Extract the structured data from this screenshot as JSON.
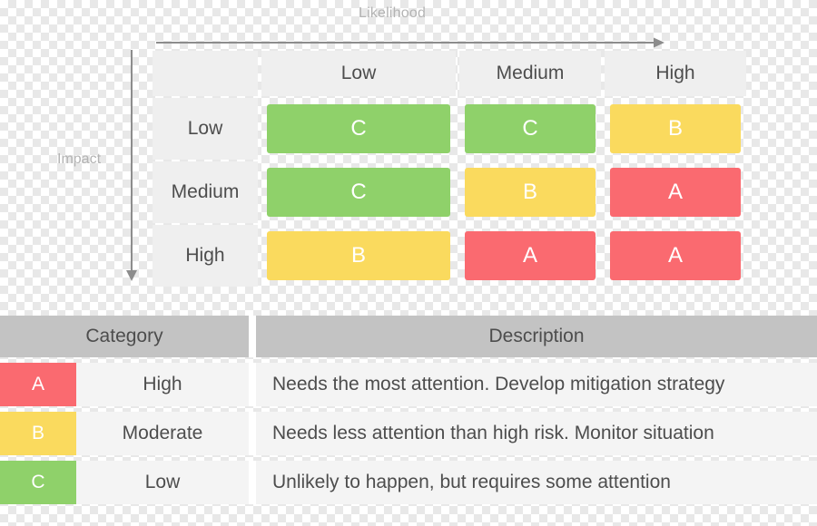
{
  "axes": {
    "x_label": "Likelihood",
    "y_label": "Impact"
  },
  "matrix": {
    "column_headers": [
      "Low",
      "Medium",
      "High"
    ],
    "row_headers": [
      "Low",
      "Medium",
      "High"
    ],
    "cells": [
      [
        {
          "label": "C",
          "color": "#8fd16a"
        },
        {
          "label": "C",
          "color": "#8fd16a"
        },
        {
          "label": "B",
          "color": "#fada5e"
        }
      ],
      [
        {
          "label": "C",
          "color": "#8fd16a"
        },
        {
          "label": "B",
          "color": "#fada5e"
        },
        {
          "label": "A",
          "color": "#fa6a70"
        }
      ],
      [
        {
          "label": "B",
          "color": "#fada5e"
        },
        {
          "label": "A",
          "color": "#fa6a70"
        },
        {
          "label": "A",
          "color": "#fa6a70"
        }
      ]
    ]
  },
  "legend": {
    "headers": {
      "category": "Category",
      "description": "Description"
    },
    "rows": [
      {
        "code": "A",
        "color": "#fa6a70",
        "level": "High",
        "description": "Needs the most attention. Develop mitigation strategy"
      },
      {
        "code": "B",
        "color": "#fada5e",
        "level": "Moderate",
        "description": "Needs less attention than high risk. Monitor situation"
      },
      {
        "code": "C",
        "color": "#8fd16a",
        "level": "Low",
        "description": "Unlikely to happen, but requires some attention"
      }
    ]
  }
}
